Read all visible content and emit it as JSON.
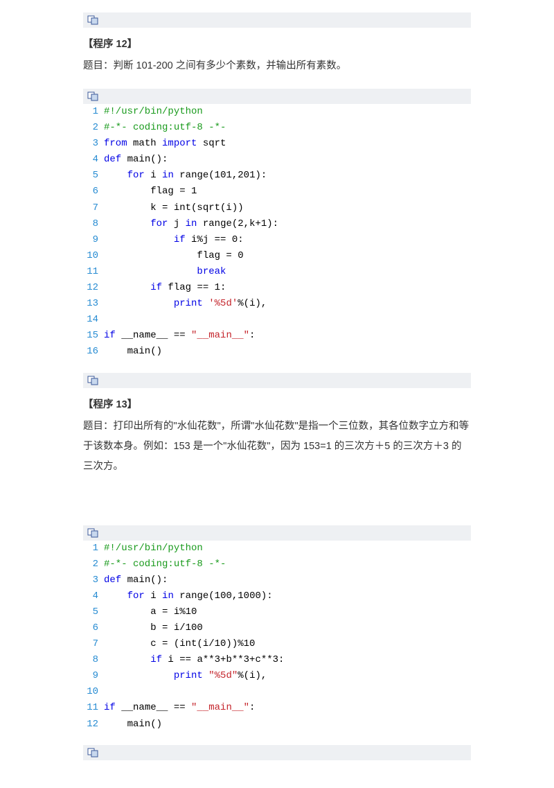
{
  "sections": [
    {
      "heading": "【程序 12】",
      "desc": "题目：判断 101-200 之间有多少个素数，并输出所有素数。",
      "code": [
        {
          "n": "1",
          "t": [
            [
              "green",
              "#!/usr/bin/python"
            ]
          ]
        },
        {
          "n": "2",
          "t": [
            [
              "green",
              "#-*- coding:utf-8 -*-"
            ]
          ]
        },
        {
          "n": "3",
          "t": [
            [
              "blue",
              "from"
            ],
            [
              "black",
              " math "
            ],
            [
              "blue",
              "import"
            ],
            [
              "black",
              " sqrt"
            ]
          ]
        },
        {
          "n": "4",
          "t": [
            [
              "blue",
              "def"
            ],
            [
              "black",
              " main():"
            ]
          ]
        },
        {
          "n": "5",
          "t": [
            [
              "black",
              "    "
            ],
            [
              "blue",
              "for"
            ],
            [
              "black",
              " i "
            ],
            [
              "blue",
              "in"
            ],
            [
              "black",
              " range(101,201):"
            ]
          ]
        },
        {
          "n": "6",
          "t": [
            [
              "black",
              "        flag = 1"
            ]
          ]
        },
        {
          "n": "7",
          "t": [
            [
              "black",
              "        k = int(sqrt(i))"
            ]
          ]
        },
        {
          "n": "8",
          "t": [
            [
              "black",
              "        "
            ],
            [
              "blue",
              "for"
            ],
            [
              "black",
              " j "
            ],
            [
              "blue",
              "in"
            ],
            [
              "black",
              " range(2,k+1):"
            ]
          ]
        },
        {
          "n": "9",
          "t": [
            [
              "black",
              "            "
            ],
            [
              "blue",
              "if"
            ],
            [
              "black",
              " i%j == 0:"
            ]
          ]
        },
        {
          "n": "10",
          "t": [
            [
              "black",
              "                flag = 0"
            ]
          ]
        },
        {
          "n": "11",
          "t": [
            [
              "black",
              "                "
            ],
            [
              "blue",
              "break"
            ]
          ]
        },
        {
          "n": "12",
          "t": [
            [
              "black",
              "        "
            ],
            [
              "blue",
              "if"
            ],
            [
              "black",
              " flag == 1:"
            ]
          ]
        },
        {
          "n": "13",
          "t": [
            [
              "black",
              "            "
            ],
            [
              "blue",
              "print"
            ],
            [
              "black",
              " "
            ],
            [
              "red",
              "'%5d'"
            ],
            [
              "black",
              "%(i),"
            ]
          ]
        },
        {
          "n": "14",
          "t": [
            [
              "black",
              ""
            ]
          ]
        },
        {
          "n": "15",
          "t": [
            [
              "blue",
              "if"
            ],
            [
              "black",
              " __name__ == "
            ],
            [
              "red",
              "\"__main__\""
            ],
            [
              "black",
              ":"
            ]
          ]
        },
        {
          "n": "16",
          "t": [
            [
              "black",
              "    main()"
            ]
          ]
        }
      ]
    },
    {
      "heading": "【程序 13】",
      "desc": "题目：打印出所有的\"水仙花数\"，所谓\"水仙花数\"是指一个三位数，其各位数字立方和等于该数本身。例如：153 是一个\"水仙花数\"，因为 153=1 的三次方＋5 的三次方＋3 的三次方。",
      "code": [
        {
          "n": "1",
          "t": [
            [
              "green",
              "#!/usr/bin/python"
            ]
          ]
        },
        {
          "n": "2",
          "t": [
            [
              "green",
              "#-*- coding:utf-8 -*-"
            ]
          ]
        },
        {
          "n": "3",
          "t": [
            [
              "blue",
              "def"
            ],
            [
              "black",
              " main():"
            ]
          ]
        },
        {
          "n": "4",
          "t": [
            [
              "black",
              "    "
            ],
            [
              "blue",
              "for"
            ],
            [
              "black",
              " i "
            ],
            [
              "blue",
              "in"
            ],
            [
              "black",
              " range(100,1000):"
            ]
          ]
        },
        {
          "n": "5",
          "t": [
            [
              "black",
              "        a = i%10"
            ]
          ]
        },
        {
          "n": "6",
          "t": [
            [
              "black",
              "        b = i/100"
            ]
          ]
        },
        {
          "n": "7",
          "t": [
            [
              "black",
              "        c = (int(i/10))%10"
            ]
          ]
        },
        {
          "n": "8",
          "t": [
            [
              "black",
              "        "
            ],
            [
              "blue",
              "if"
            ],
            [
              "black",
              " i == a**3+b**3+c**3:"
            ]
          ]
        },
        {
          "n": "9",
          "t": [
            [
              "black",
              "            "
            ],
            [
              "blue",
              "print"
            ],
            [
              "black",
              " "
            ],
            [
              "red",
              "\"%5d\""
            ],
            [
              "black",
              "%(i),"
            ]
          ]
        },
        {
          "n": "10",
          "t": [
            [
              "black",
              ""
            ]
          ]
        },
        {
          "n": "11",
          "t": [
            [
              "blue",
              "if"
            ],
            [
              "black",
              " __name__ == "
            ],
            [
              "red",
              "\"__main__\""
            ],
            [
              "black",
              ":"
            ]
          ]
        },
        {
          "n": "12",
          "t": [
            [
              "black",
              "    main()"
            ]
          ]
        }
      ]
    }
  ]
}
